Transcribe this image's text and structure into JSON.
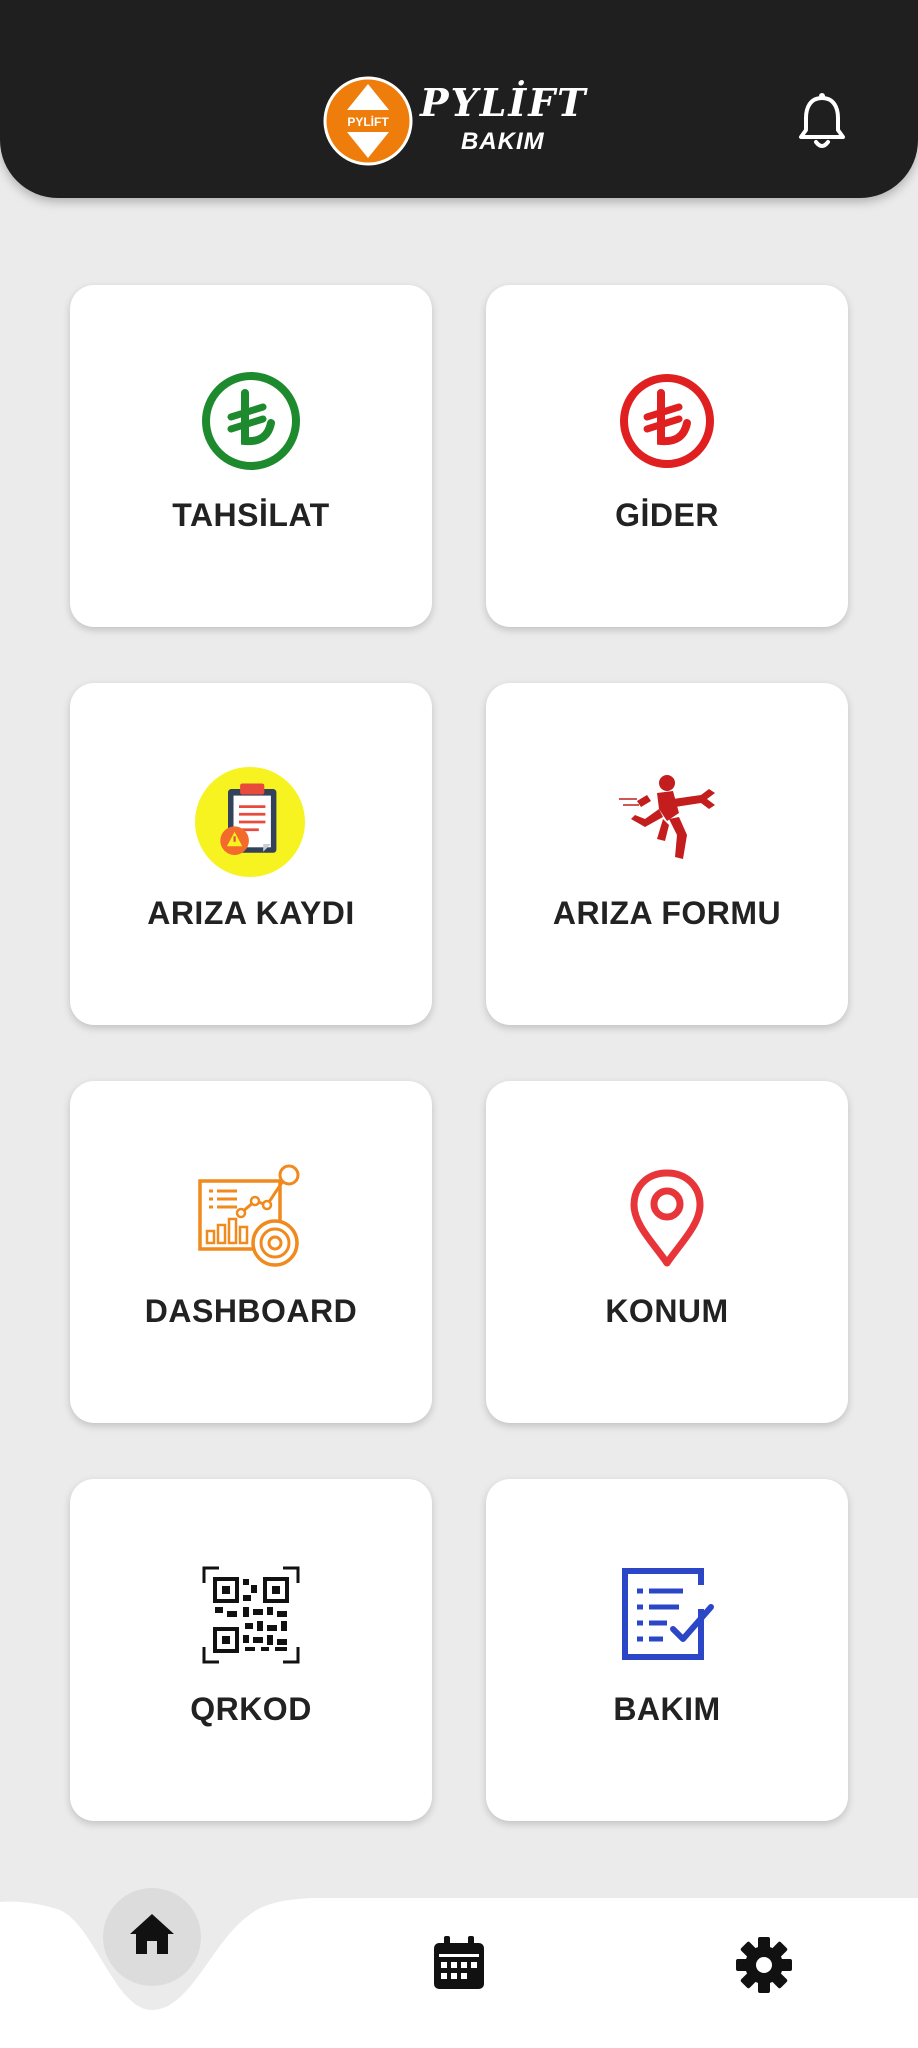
{
  "header": {
    "brand_name": "PYLİFT",
    "brand_sub": "BAKIM",
    "logo_badge": "PYLİFT",
    "logo_icon": "pylift-logo",
    "notification_icon": "bell-icon"
  },
  "tiles": [
    {
      "label": "TAHSİLAT",
      "icon": "lira-icon",
      "color": "#1e8a2e"
    },
    {
      "label": "GİDER",
      "icon": "lira-icon",
      "color": "#e02020"
    },
    {
      "label": "ARIZA KAYDI",
      "icon": "clipboard-warning-icon",
      "color": "#f7f321"
    },
    {
      "label": "ARIZA FORMU",
      "icon": "running-mechanic-icon",
      "color": "#c41d1d"
    },
    {
      "label": "DASHBOARD",
      "icon": "analytics-dashboard-icon",
      "color": "#f08a1c"
    },
    {
      "label": "KONUM",
      "icon": "map-pin-icon",
      "color": "#e8353a"
    },
    {
      "label": "QRKOD",
      "icon": "qr-code-icon",
      "color": "#111111"
    },
    {
      "label": "BAKIM",
      "icon": "checklist-icon",
      "color": "#2b46c6"
    }
  ],
  "navbar": {
    "items": [
      {
        "icon": "home-icon",
        "active": true
      },
      {
        "icon": "calendar-icon",
        "active": false
      },
      {
        "icon": "settings-gear-icon",
        "active": false
      }
    ]
  },
  "colors": {
    "header_bg": "#1f1f1f",
    "page_bg": "#ebebeb",
    "brand_orange": "#ef7d0b"
  }
}
